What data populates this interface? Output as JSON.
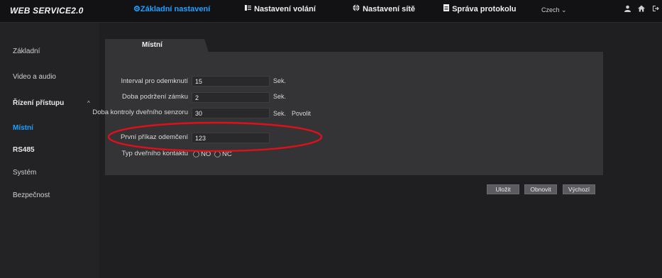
{
  "header": {
    "logo": "WEB SERVICE2.0",
    "tabs": [
      {
        "label": "⚙Základní nastavení",
        "active": true
      },
      {
        "label": "Nastavení volání",
        "icon": "phone-list-icon"
      },
      {
        "label": "Nastavení sítě",
        "icon": "globe-icon"
      },
      {
        "label": "Správa protokolu",
        "icon": "document-icon"
      }
    ],
    "language": "Czech",
    "language_arrow": "⌄",
    "icons": [
      "user-icon",
      "home-icon",
      "logout-icon"
    ]
  },
  "sidebar": {
    "items": [
      {
        "label": "Základní"
      },
      {
        "label": "Video a audio"
      },
      {
        "label": "Řízení přístupu",
        "expandable": true
      },
      {
        "label": "Místní",
        "active": true
      },
      {
        "label": "RS485"
      },
      {
        "label": "Systém"
      },
      {
        "label": "Bezpečnost"
      }
    ],
    "chevron": "^"
  },
  "main": {
    "tab": "Místní",
    "fields": [
      {
        "label": "Interval pro odemknutí",
        "value": "15",
        "unit": "Sek."
      },
      {
        "label": "Doba podržení zámku",
        "value": "2",
        "unit": "Sek."
      },
      {
        "label": "Doba kontroly dveřního senzoru",
        "value": "30",
        "unit": "Sek.",
        "extra": "Povolit"
      },
      {
        "label": "První příkaz odemčení",
        "value": "123"
      }
    ],
    "contact_type": {
      "label": "Typ dveřního kontaktu",
      "options": [
        "NO",
        "NC"
      ]
    },
    "buttons": {
      "save": "Uložit",
      "refresh": "Obnovit",
      "default": "Výchozí"
    }
  },
  "colors": {
    "accent": "#1ea0ff",
    "highlight_oval": "#e0101a"
  }
}
